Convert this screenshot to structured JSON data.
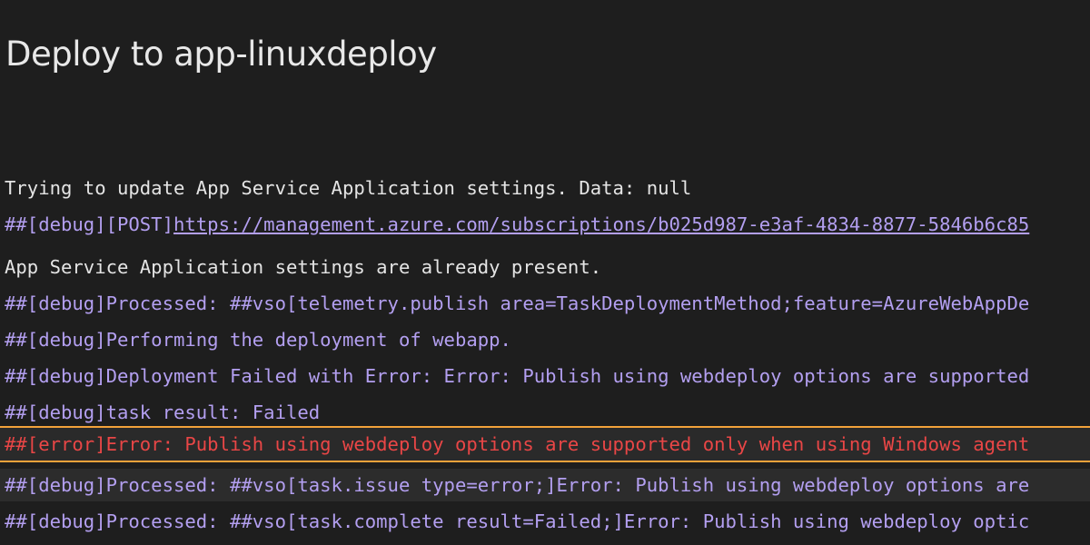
{
  "title": "Deploy to app-linuxdeploy",
  "log": {
    "line1": "Trying to update App Service Application settings. Data: null",
    "line2_prefix": "##[debug][POST]",
    "line2_url": "https://management.azure.com/subscriptions/b025d987-e3af-4834-8877-5846b6c85",
    "line3": "App Service Application settings are already present.",
    "line4": "##[debug]Processed: ##vso[telemetry.publish area=TaskDeploymentMethod;feature=AzureWebAppDe",
    "line5": "##[debug]Performing the deployment of webapp.",
    "line6": "##[debug]Deployment Failed with Error: Error: Publish using webdeploy options are supported",
    "line7": "##[debug]task result: Failed",
    "line8": "##[error]Error: Publish using webdeploy options are supported only when using Windows agent",
    "line9": "##[debug]Processed: ##vso[task.issue type=error;]Error: Publish using webdeploy options are",
    "line10": "##[debug]Processed: ##vso[task.complete result=Failed;]Error: Publish using webdeploy optic"
  },
  "colors": {
    "background": "#1e1e1e",
    "debug": "#b39ff0",
    "error": "#e94646",
    "highlight_border": "#f2a23a"
  }
}
